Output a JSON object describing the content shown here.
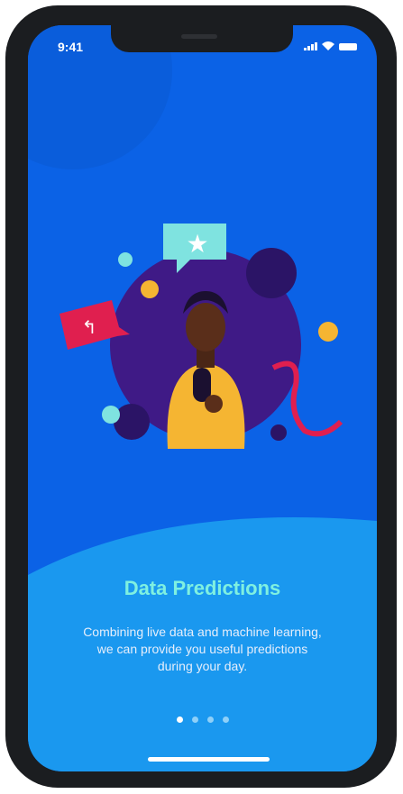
{
  "status_bar": {
    "time": "9:41",
    "icons": [
      "signal-icon",
      "wifi-icon",
      "battery-icon"
    ]
  },
  "onboarding": {
    "title": "Data Predictions",
    "description": "Combining live data and machine learning, we can provide you useful predictions during your day.",
    "page_count": 4,
    "current_page": 1
  },
  "colors": {
    "background_top": "#0b62e6",
    "background_bottom": "#1a98ef",
    "title": "#7ff0e0",
    "circle": "#3f1a86",
    "shirt": "#f5b532",
    "accent_red": "#e01f4f"
  }
}
